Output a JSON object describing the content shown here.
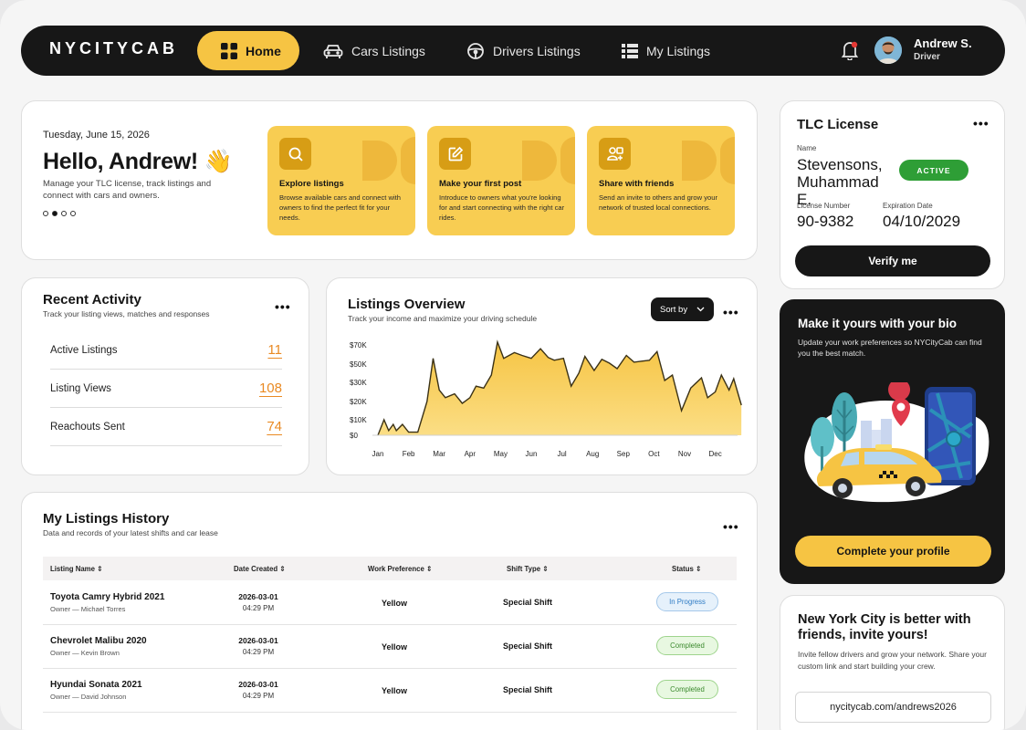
{
  "nav": {
    "logo": "NYCITYCAB",
    "items": [
      {
        "label": "Home",
        "icon": "grid-icon"
      },
      {
        "label": "Cars Listings",
        "icon": "car-icon"
      },
      {
        "label": "Drivers Listings",
        "icon": "steering-wheel-icon"
      },
      {
        "label": "My Listings",
        "icon": "list-icon"
      }
    ],
    "user": {
      "name": "Andrew S.",
      "role": "Driver"
    }
  },
  "welcome": {
    "date": "Tuesday, June 15, 2026",
    "greeting": "Hello, Andrew! 👋",
    "subtitle": "Manage your TLC license, track listings and connect with cars and owners.",
    "promos": [
      {
        "title": "Explore listings",
        "desc": "Browse available cars and connect with owners to find the perfect fit for your needs.",
        "icon": "search-icon"
      },
      {
        "title": "Make your first post",
        "desc": "Introduce to owners what you're looking for and start connecting with the right car rides.",
        "icon": "edit-icon"
      },
      {
        "title": "Share with friends",
        "desc": "Send an invite to others and grow your network of trusted local connections.",
        "icon": "share-users-icon"
      }
    ]
  },
  "tlc": {
    "title": "TLC License",
    "name_label": "Name",
    "name": "Stevensons, Muhammad E.",
    "status": "ACTIVE",
    "license_label": "License Number",
    "license": "90-9382",
    "expiration_label": "Expiration Date",
    "expiration": "04/10/2029",
    "verify_label": "Verify me"
  },
  "recent": {
    "title": "Recent Activity",
    "subtitle": "Track your listing views, matches and responses",
    "rows": [
      {
        "label": "Active Listings",
        "value": "11"
      },
      {
        "label": "Listing Views",
        "value": "108"
      },
      {
        "label": "Reachouts Sent",
        "value": "74"
      }
    ]
  },
  "overview": {
    "title": "Listings Overview",
    "subtitle": "Track your income and maximize your driving schedule",
    "sort_label": "Sort by"
  },
  "chart_data": {
    "type": "area",
    "x_ticks": [
      "Jan",
      "Feb",
      "Mar",
      "Apr",
      "May",
      "Jun",
      "Jul",
      "Aug",
      "Sep",
      "Oct",
      "Nov",
      "Dec"
    ],
    "y_ticks": [
      "$70K",
      "$50K",
      "$30K",
      "$20K",
      "$10K",
      "$0"
    ],
    "x": [
      0.0,
      0.2,
      0.35,
      0.5,
      0.6,
      0.8,
      1.0,
      1.3,
      1.6,
      1.8,
      2.0,
      2.2,
      2.5,
      2.75,
      3.0,
      3.2,
      3.45,
      3.7,
      3.9,
      4.1,
      4.45,
      4.7,
      5.0,
      5.3,
      5.55,
      5.75,
      6.05,
      6.3,
      6.55,
      6.75,
      7.05,
      7.3,
      7.55,
      7.8,
      8.1,
      8.35,
      8.6,
      8.85,
      9.1,
      9.35,
      9.6,
      9.9,
      10.2,
      10.55,
      10.75,
      11.0,
      11.2,
      11.45,
      11.6,
      11.85
    ],
    "y": [
      0,
      10,
      3,
      7,
      3,
      7,
      2,
      2,
      20,
      56,
      26,
      22,
      24,
      19,
      22,
      28,
      27,
      38,
      73,
      56,
      62,
      59,
      56,
      66,
      57,
      54,
      56,
      28,
      40,
      58,
      43,
      55,
      51,
      45,
      59,
      52,
      53,
      54,
      63,
      32,
      38,
      15,
      27,
      35,
      22,
      25,
      38,
      26,
      34,
      18
    ],
    "y_axis": "piecewise dollar scale as labeled",
    "grid": false,
    "fill_color": "#f8cd52"
  },
  "bio": {
    "title": "Make it yours with your bio",
    "subtitle": "Update your work preferences so NYCityCab can find you the best match.",
    "button": "Complete your profile"
  },
  "history": {
    "title": "My Listings History",
    "subtitle": "Data and records of your latest shifts and car lease",
    "columns": [
      "Listing Name",
      "Date Created",
      "Work Preference",
      "Shift Type",
      "Status"
    ],
    "rows": [
      {
        "name": "Toyota Camry Hybrid 2021",
        "owner": "Owner — Michael Torres",
        "date": "2026-03-01",
        "time": "04:29 PM",
        "pref": "Yellow",
        "shift": "Special Shift",
        "status": "In Progress"
      },
      {
        "name": "Chevrolet Malibu 2020",
        "owner": "Owner — Kevin Brown",
        "date": "2026-03-01",
        "time": "04:29 PM",
        "pref": "Yellow",
        "shift": "Special Shift",
        "status": "Completed"
      },
      {
        "name": "Hyundai Sonata 2021",
        "owner": "Owner — David Johnson",
        "date": "2026-03-01",
        "time": "04:29 PM",
        "pref": "Yellow",
        "shift": "Special Shift",
        "status": "Completed"
      }
    ]
  },
  "invite": {
    "title": "New York City is better with friends, invite yours!",
    "subtitle": "Invite fellow drivers and grow your network. Share your custom link and start building your crew.",
    "link": "nycitycab.com/andrews2026"
  }
}
